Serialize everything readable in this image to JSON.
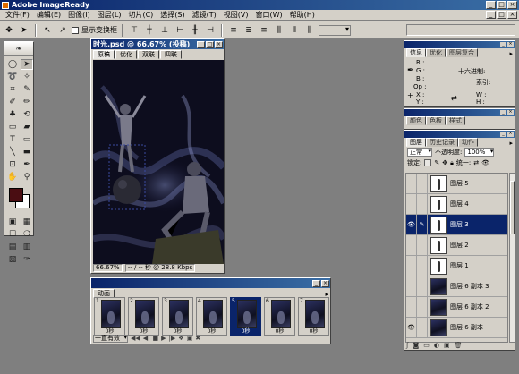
{
  "app": {
    "title": "Adobe ImageReady"
  },
  "menu": [
    "文件(F)",
    "编辑(E)",
    "图像(I)",
    "图层(L)",
    "切片(C)",
    "选择(S)",
    "滤镜(T)",
    "视图(V)",
    "窗口(W)",
    "帮助(H)"
  ],
  "options": {
    "show_transform_label": "显示变换框"
  },
  "colors": {
    "foreground": "#4a0d12",
    "background": "#ffffff",
    "titlebar": "#0a246a"
  },
  "document": {
    "title": "时光.psd @ 66.67% (投稿)",
    "tabs": [
      "原稿",
      "优化",
      "双联",
      "四联"
    ],
    "zoom": "66.67%",
    "download": "-- / -- 秒 @ 28.8 Kbps"
  },
  "animation": {
    "tab": "动画",
    "frames": [
      {
        "num": "1",
        "delay": "0秒"
      },
      {
        "num": "2",
        "delay": "0秒"
      },
      {
        "num": "3",
        "delay": "0秒"
      },
      {
        "num": "4",
        "delay": "0秒"
      },
      {
        "num": "5",
        "delay": "0秒"
      },
      {
        "num": "6",
        "delay": "0秒"
      },
      {
        "num": "7",
        "delay": "0秒"
      }
    ],
    "selected_frame": 5,
    "loop": "一直有效"
  },
  "info_panel": {
    "tabs": [
      "信息",
      "优化",
      "图层复合"
    ],
    "labels": {
      "r": "R :",
      "g": "G :",
      "b": "B :",
      "op": "Op :",
      "x": "X :",
      "y": "Y :",
      "w": "W :",
      "h": "H :",
      "hex": "十六进制:",
      "index": "索引:"
    }
  },
  "color_panel": {
    "tabs": [
      "颜色",
      "色板",
      "样式"
    ]
  },
  "layers_panel": {
    "tabs": [
      "图层",
      "历史记录",
      "动作"
    ],
    "blend_mode": "正常",
    "opacity_label": "不透明度:",
    "opacity": "100%",
    "lock_label": "锁定:",
    "unify_label": "统一:",
    "layers": [
      {
        "name": "图层 5",
        "visible": false,
        "thumb": "fig"
      },
      {
        "name": "图层 4",
        "visible": false,
        "thumb": "fig"
      },
      {
        "name": "图层 3",
        "visible": true,
        "thumb": "fig",
        "selected": true
      },
      {
        "name": "图层 2",
        "visible": false,
        "thumb": "fig"
      },
      {
        "name": "图层 1",
        "visible": false,
        "thumb": "fig"
      },
      {
        "name": "图层 6 副本 3",
        "visible": false,
        "thumb": "dark"
      },
      {
        "name": "图层 6 副本 2",
        "visible": false,
        "thumb": "dark"
      },
      {
        "name": "图层 6 副本",
        "visible": true,
        "thumb": "dark"
      }
    ]
  }
}
